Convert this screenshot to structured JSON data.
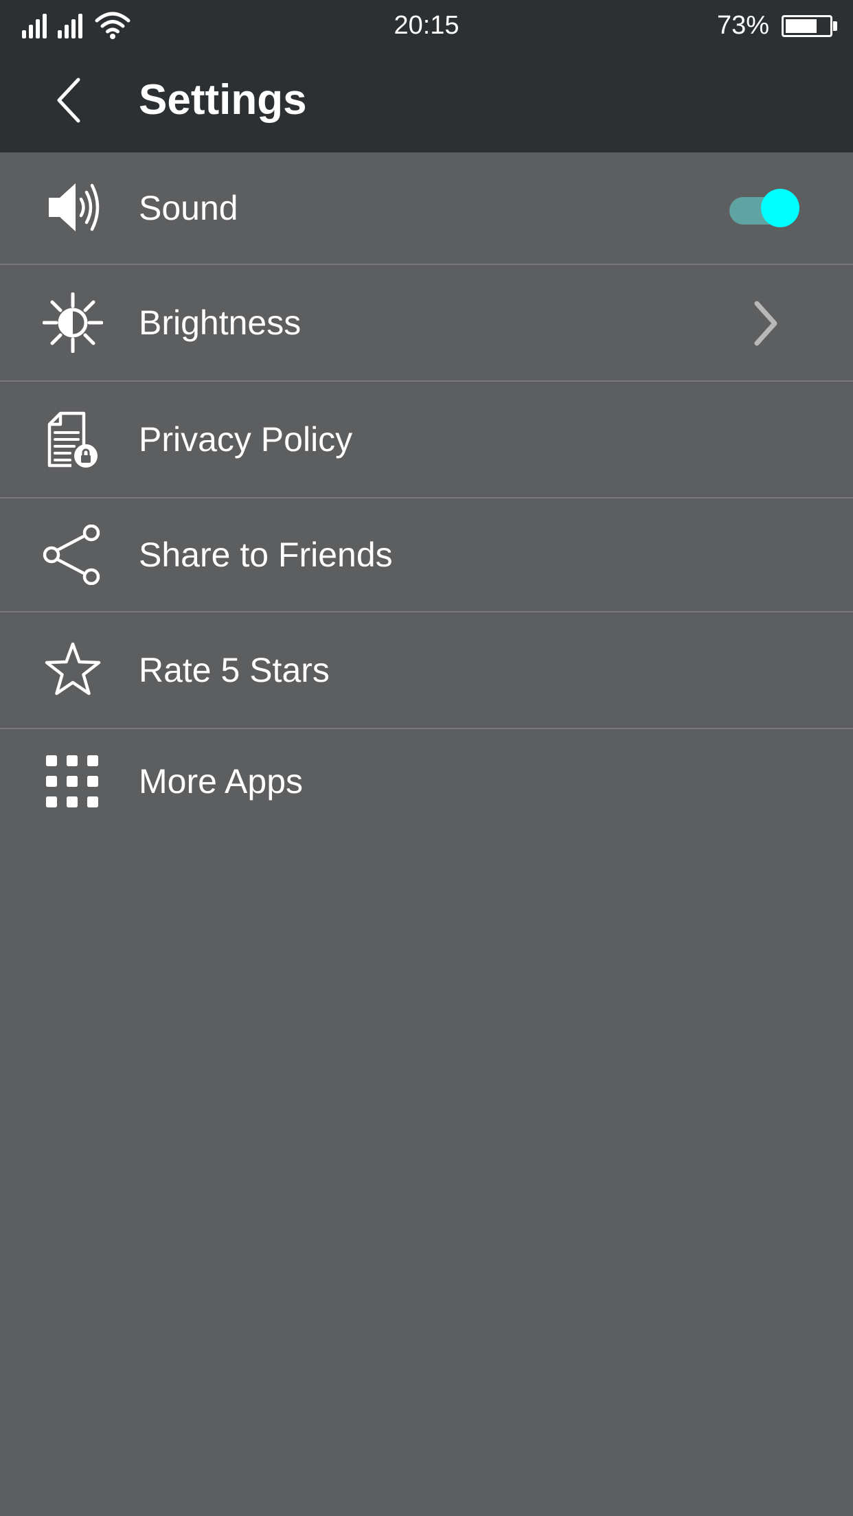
{
  "status_bar": {
    "time": "20:15",
    "battery_percent": "73%",
    "battery_level": 0.73,
    "signal_icons": [
      "signal-icon",
      "signal-icon"
    ],
    "wifi_icon": "wifi-icon",
    "battery_icon": "battery-icon"
  },
  "header": {
    "title": "Settings",
    "back_icon": "chevron-left-icon"
  },
  "settings": {
    "items": [
      {
        "label": "Sound",
        "icon": "speaker-icon",
        "control": "toggle",
        "toggle_on": true
      },
      {
        "label": "Brightness",
        "icon": "brightness-icon",
        "control": "chevron"
      },
      {
        "label": "Privacy Policy",
        "icon": "privacy-document-icon"
      },
      {
        "label": "Share to Friends",
        "icon": "share-icon"
      },
      {
        "label": "Rate 5 Stars",
        "icon": "star-icon"
      },
      {
        "label": "More Apps",
        "icon": "grid-icon"
      }
    ]
  },
  "colors": {
    "background": "#5d5e60",
    "header_background": "#2d3033",
    "divider": "#79797b",
    "toggle_track": "#5fa3a3",
    "toggle_knob": "#00ffff",
    "chevron": "#b8b8b8"
  }
}
